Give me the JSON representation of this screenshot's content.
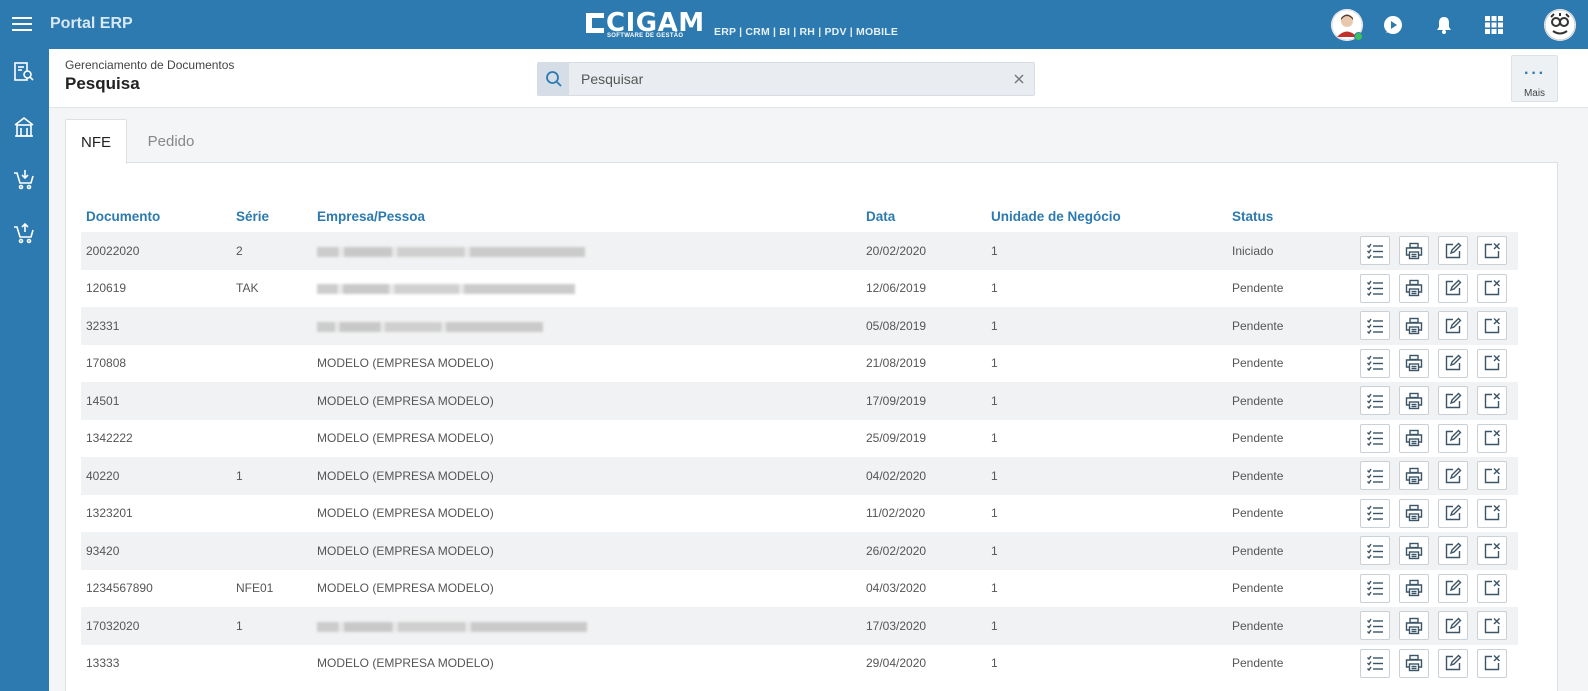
{
  "app": {
    "title": "Portal ERP",
    "brand_name": "CIGAM",
    "brand_tagline": "SOFTWARE DE GESTÃO",
    "brand_modules": "ERP | CRM | BI | RH | PDV | MOBILE",
    "accent_color": "#2c7ab0"
  },
  "topbar_icons": [
    "menu-icon",
    "user-avatar",
    "play-icon",
    "bell-icon",
    "apps-grid-icon",
    "company-avatar"
  ],
  "sidebar": {
    "items": [
      {
        "icon": "document-search-icon"
      },
      {
        "icon": "building-icon"
      },
      {
        "icon": "cart-download-icon"
      },
      {
        "icon": "cart-upload-icon"
      }
    ]
  },
  "header": {
    "breadcrumb": "Gerenciamento de Documentos",
    "title": "Pesquisa",
    "search_placeholder": "Pesquisar",
    "more_label": "Mais",
    "more_glyph": "···"
  },
  "tabs": [
    {
      "label": "NFE",
      "active": true
    },
    {
      "label": "Pedido",
      "active": false
    }
  ],
  "table": {
    "columns": [
      "Documento",
      "Série",
      "Empresa/Pessoa",
      "Data",
      "Unidade de Negócio",
      "Status"
    ],
    "rows": [
      {
        "documento": "20022020",
        "serie": "2",
        "empresa": "",
        "empresa_blurred": true,
        "data": "20/02/2020",
        "unidade": "1",
        "status": "Iniciado"
      },
      {
        "documento": "120619",
        "serie": "TAK",
        "empresa": "",
        "empresa_blurred": true,
        "data": "12/06/2019",
        "unidade": "1",
        "status": "Pendente"
      },
      {
        "documento": "32331",
        "serie": "",
        "empresa": "",
        "empresa_blurred": true,
        "data": "05/08/2019",
        "unidade": "1",
        "status": "Pendente"
      },
      {
        "documento": "170808",
        "serie": "",
        "empresa": "MODELO (EMPRESA MODELO)",
        "empresa_blurred": false,
        "data": "21/08/2019",
        "unidade": "1",
        "status": "Pendente"
      },
      {
        "documento": "14501",
        "serie": "",
        "empresa": "MODELO (EMPRESA MODELO)",
        "empresa_blurred": false,
        "data": "17/09/2019",
        "unidade": "1",
        "status": "Pendente"
      },
      {
        "documento": "1342222",
        "serie": "",
        "empresa": "MODELO (EMPRESA MODELO)",
        "empresa_blurred": false,
        "data": "25/09/2019",
        "unidade": "1",
        "status": "Pendente"
      },
      {
        "documento": "40220",
        "serie": "1",
        "empresa": "MODELO (EMPRESA MODELO)",
        "empresa_blurred": false,
        "data": "04/02/2020",
        "unidade": "1",
        "status": "Pendente"
      },
      {
        "documento": "1323201",
        "serie": "",
        "empresa": "MODELO (EMPRESA MODELO)",
        "empresa_blurred": false,
        "data": "11/02/2020",
        "unidade": "1",
        "status": "Pendente"
      },
      {
        "documento": "93420",
        "serie": "",
        "empresa": "MODELO (EMPRESA MODELO)",
        "empresa_blurred": false,
        "data": "26/02/2020",
        "unidade": "1",
        "status": "Pendente"
      },
      {
        "documento": "1234567890",
        "serie": "NFE01",
        "empresa": "MODELO (EMPRESA MODELO)",
        "empresa_blurred": false,
        "data": "04/03/2020",
        "unidade": "1",
        "status": "Pendente"
      },
      {
        "documento": "17032020",
        "serie": "1",
        "empresa": "",
        "empresa_blurred": true,
        "data": "17/03/2020",
        "unidade": "1",
        "status": "Pendente"
      },
      {
        "documento": "13333",
        "serie": "",
        "empresa": "MODELO (EMPRESA MODELO)",
        "empresa_blurred": false,
        "data": "29/04/2020",
        "unidade": "1",
        "status": "Pendente"
      }
    ],
    "row_actions": [
      "checklist-icon",
      "print-icon",
      "edit-icon",
      "cancel-document-icon"
    ]
  }
}
